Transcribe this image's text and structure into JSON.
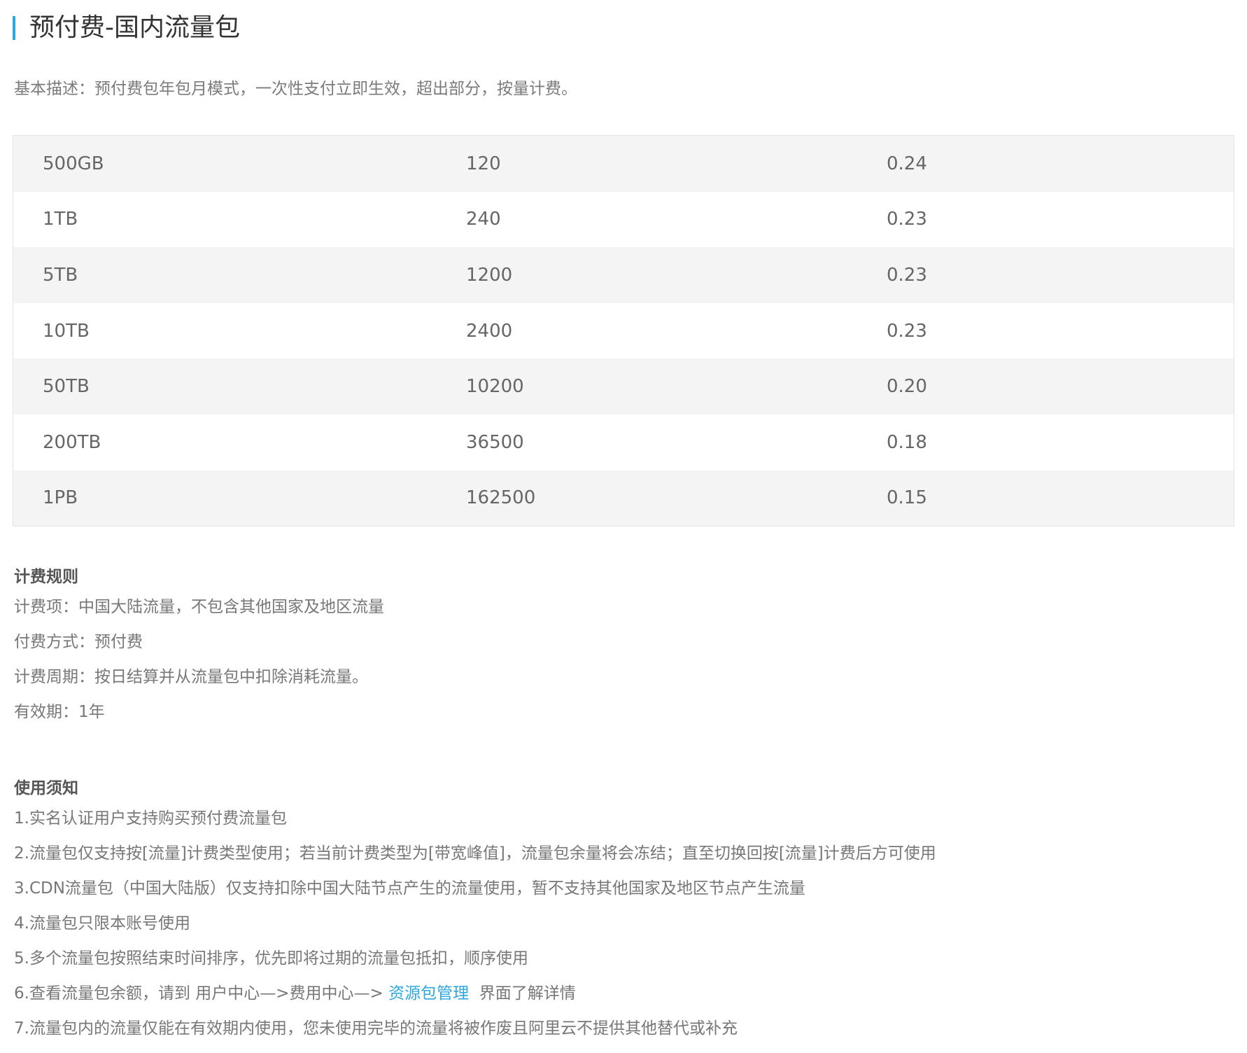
{
  "title": "预付费-国内流量包",
  "description": "基本描述：预付费包年包月模式，一次性支付立即生效，超出部分，按量计费。",
  "price_table": {
    "rows": [
      [
        "500GB",
        "120",
        "0.24"
      ],
      [
        "1TB",
        "240",
        "0.23"
      ],
      [
        "5TB",
        "1200",
        "0.23"
      ],
      [
        "10TB",
        "2400",
        "0.23"
      ],
      [
        "50TB",
        "10200",
        "0.20"
      ],
      [
        "200TB",
        "36500",
        "0.18"
      ],
      [
        "1PB",
        "162500",
        "0.15"
      ]
    ]
  },
  "billing_rules": {
    "heading": "计费规则",
    "lines": [
      "计费项：中国大陆流量，不包含其他国家及地区流量",
      "付费方式：预付费",
      "计费周期：按日结算并从流量包中扣除消耗流量。",
      "有效期：1年"
    ]
  },
  "usage_notes": {
    "heading": "使用须知",
    "lines": [
      "1.实名认证用户支持购买预付费流量包",
      "2.流量包仅支持按[流量]计费类型使用；若当前计费类型为[带宽峰值]，流量包余量将会冻结；直至切换回按[流量]计费后方可使用",
      "3.CDN流量包（中国大陆版）仅支持扣除中国大陆节点产生的流量使用，暂不支持其他国家及地区节点产生流量",
      "4.流量包只限本账号使用",
      "5.多个流量包按照结束时间排序，优先即将过期的流量包抵扣，顺序使用"
    ],
    "line6_prefix": "6.查看流量包余额，请到 用户中心—>费用中心—> ",
    "line6_link": "资源包管理",
    "line6_suffix": "  界面了解详情",
    "line7": "7.流量包内的流量仅能在有效期内使用，您未使用完毕的流量将被作废且阿里云不提供其他替代或补充"
  },
  "colors": {
    "accent": "#2ea7e0"
  }
}
